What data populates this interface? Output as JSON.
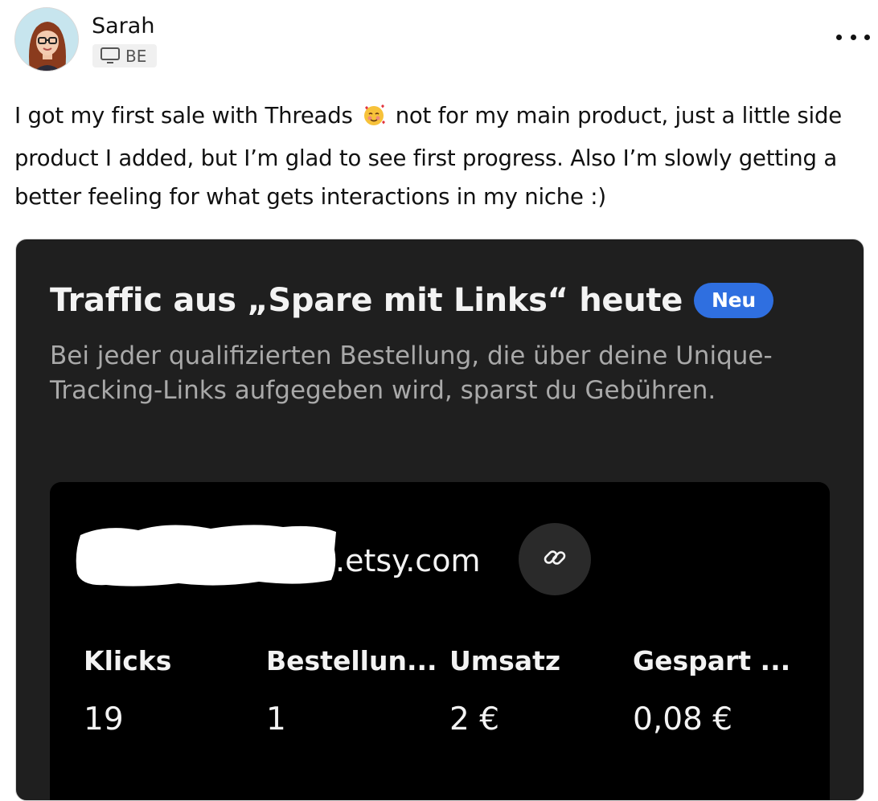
{
  "post": {
    "author": "Sarah",
    "badge": "BE",
    "text_part1": "I got my first sale with Threads",
    "text_part2": "not for my main product, just a little side product I added, but I’m glad to see first progress. Also I’m slowly getting a better feeling for what gets interactions in my niche :)",
    "emoji_icon": "smiling-face-with-hearts-icon"
  },
  "screenshot": {
    "title": "Traffic aus „Spare mit Links“ heute",
    "badge": "Neu",
    "description": "Bei jeder qualifizierten Bestellung, die über deine Unique-Tracking-Links aufgegeben wird, sparst du Gebühren.",
    "domain": ".etsy.com",
    "stats": [
      {
        "label": "Klicks",
        "value": "19"
      },
      {
        "label": "Bestellun...",
        "value": "1"
      },
      {
        "label": "Umsatz",
        "value": "2 €"
      },
      {
        "label": "Gespart ...",
        "value": "0,08 €"
      }
    ]
  },
  "colors": {
    "card_bg": "#1f1f1f",
    "inner_bg": "#000000",
    "accent_badge": "#2f6fe0",
    "muted_text": "#a9a9a9"
  }
}
